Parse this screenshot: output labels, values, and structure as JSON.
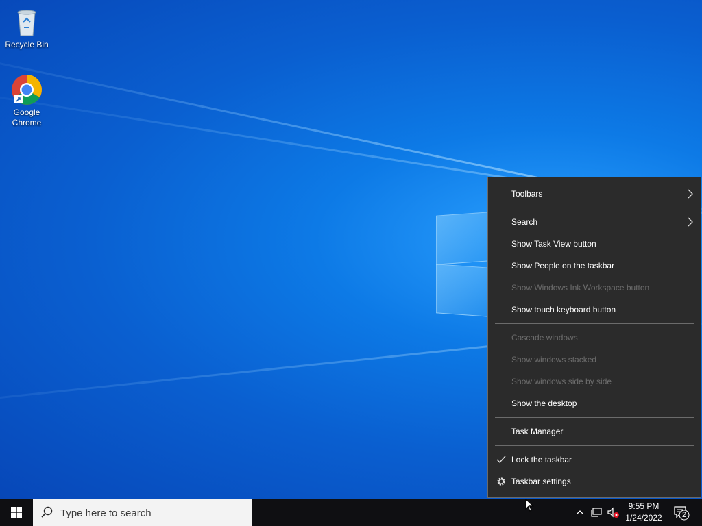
{
  "desktop": {
    "icons": [
      {
        "label": "Recycle Bin"
      },
      {
        "label": "Google Chrome"
      }
    ]
  },
  "context_menu": {
    "items": [
      {
        "label": "Toolbars",
        "enabled": true,
        "submenu": true
      },
      {
        "label": "Search",
        "enabled": true,
        "submenu": true
      },
      {
        "label": "Show Task View button",
        "enabled": true
      },
      {
        "label": "Show People on the taskbar",
        "enabled": true
      },
      {
        "label": "Show Windows Ink Workspace button",
        "enabled": false
      },
      {
        "label": "Show touch keyboard button",
        "enabled": true
      },
      {
        "label": "Cascade windows",
        "enabled": false
      },
      {
        "label": "Show windows stacked",
        "enabled": false
      },
      {
        "label": "Show windows side by side",
        "enabled": false
      },
      {
        "label": "Show the desktop",
        "enabled": true
      },
      {
        "label": "Task Manager",
        "enabled": true
      },
      {
        "label": "Lock the taskbar",
        "enabled": true,
        "checked": true
      },
      {
        "label": "Taskbar settings",
        "enabled": true,
        "icon": "gear-icon"
      }
    ]
  },
  "taskbar": {
    "search_placeholder": "Type here to search",
    "clock": {
      "time": "9:55 PM",
      "date": "1/24/2022"
    },
    "notifications_count": "2"
  },
  "colors": {
    "menu_bg": "#2b2b2b",
    "menu_disabled_text": "#6d6d6d",
    "taskbar_bg": "#0f0f12",
    "desktop_accent": "#0a5fd0"
  }
}
